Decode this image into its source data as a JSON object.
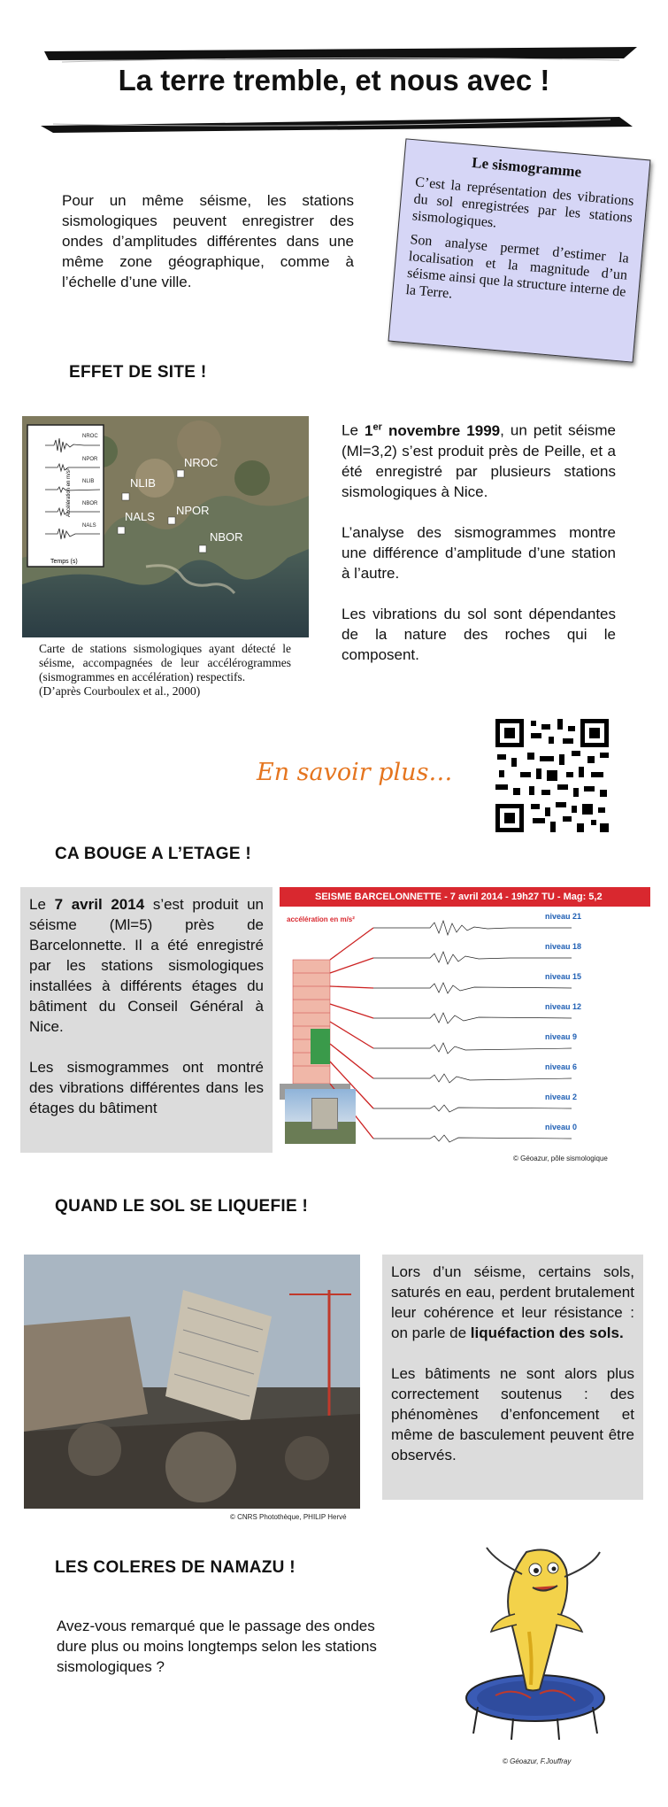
{
  "title": "La terre tremble, et nous avec !",
  "intro": "Pour un même séisme, les stations sismologiques peuvent enregistrer des ondes d’amplitudes différentes dans une même zone géographique, comme à l’échelle d’une ville.",
  "sismogramme": {
    "heading": "Le sismogramme",
    "p1": "C’est la représentation des vibrations du sol enregistrées par les stations sismologiques.",
    "p2": "Son analyse permet d’estimer la localisation et la magnitude d’un séisme ainsi que la structure interne de la Terre."
  },
  "effet_site": {
    "heading": "EFFET DE SITE !",
    "map_stations": [
      "NROC",
      "NLIB",
      "NALS",
      "NPOR",
      "NBOR"
    ],
    "inset_rows": [
      "NROC",
      "NPOR",
      "NLIB",
      "NBOR",
      "NALS"
    ],
    "inset_ylabel": "Accélération en m/s²",
    "inset_xlabel": "Temps (s)",
    "caption": "Carte de stations sismologiques ayant détecté le séisme, accompagnées de leur accélérogrammes (sismogrammes en accélération) respectifs.",
    "source": "(D’après Courboulex et al., 2000)",
    "p1_pre": "Le ",
    "p1_date": "1",
    "p1_sup": "er",
    "p1_date2": " novembre 1999",
    "p1_post": ", un petit séisme (Ml=3,2) s’est produit près de Peille, et a été enregistré par plusieurs stations sismologiques à Nice.",
    "p2": "L’analyse des sismogrammes montre une différence d’amplitude d’une station à l’autre.",
    "p3": "Les vibrations du sol sont dépendantes de  la nature des roches qui le composent."
  },
  "en_savoir_plus": "En savoir plus…",
  "etage": {
    "heading": "CA BOUGE A L’ETAGE !",
    "p1_pre": "Le ",
    "p1_date": "7 avril 2014",
    "p1_post": " s’est produit un séisme (Ml=5) près de Barcelonnette. Il a été enregistré par les stations sismologiques installées à différents étages du bâtiment du Conseil Général à Nice.",
    "p2": "Les sismogrammes ont montré des vibrations différentes dans les étages du bâtiment",
    "figure_title": "SEISME BARCELONNETTE - 7 avril 2014 - 19h27 TU - Mag: 5,2",
    "figure_ylabel": "accélération en m/s²",
    "levels": [
      "niveau 21",
      "niveau 18",
      "niveau 15",
      "niveau 12",
      "niveau 9",
      "niveau 6",
      "niveau 2",
      "niveau 0"
    ],
    "credit": "© Géoazur,  pôle sismologique"
  },
  "liquefie": {
    "heading": "QUAND LE SOL SE LIQUEFIE !",
    "p1_pre": "Lors d’un séisme, certains sols, saturés en eau, perdent brutalement leur cohérence et leur résistance : on parle de ",
    "p1_bold": "liquéfaction des sols.",
    "p2": "Les bâtiments ne sont alors plus correctement soutenus : des phénomènes d’enfoncement et même de basculement peuvent être observés.",
    "credit": "© CNRS Photothèque,  PHILIP Hervé"
  },
  "namazu": {
    "heading": "LES COLERES DE NAMAZU !",
    "text": "Avez-vous remarqué que le passage des ondes dure plus ou moins longtemps selon les stations sismologiques ?",
    "credit": "© Géoazur,  F.Jouffray"
  },
  "colors": {
    "sismo_box": "#d6d6f6",
    "gray_box": "#dcdcdc",
    "en_savoir_plus": "#e5751f",
    "figure_header": "#d9282f",
    "level_label": "#1f5fb4"
  }
}
